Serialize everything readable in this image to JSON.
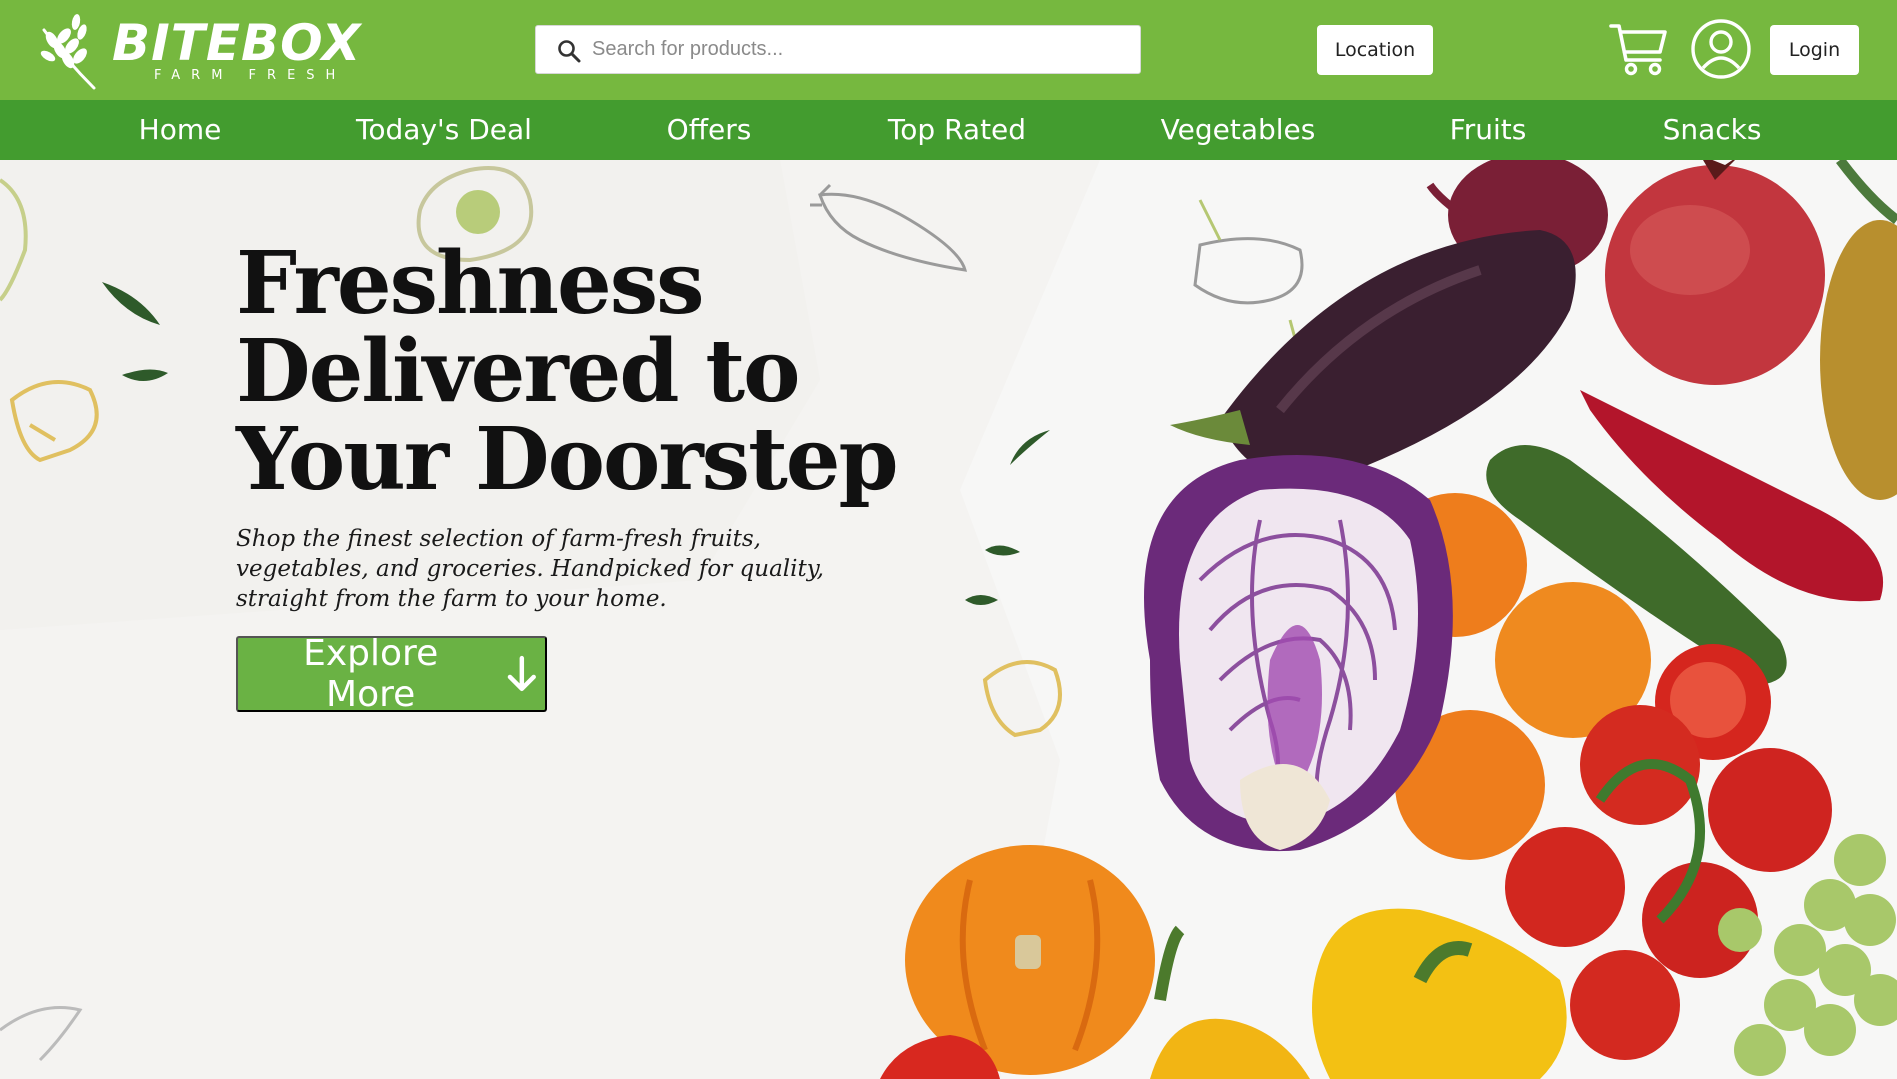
{
  "brand": {
    "name": "BITEBOX",
    "tagline": "FARM FRESH",
    "logo_icon": "wheat-icon"
  },
  "header": {
    "search": {
      "placeholder": "Search for products...",
      "value": "",
      "icon": "search-icon"
    },
    "location_label": "Location",
    "cart_icon": "shopping-cart-icon",
    "account_icon": "user-account-icon",
    "login_label": "Login"
  },
  "nav": {
    "items": [
      {
        "label": "Home"
      },
      {
        "label": "Today's Deal"
      },
      {
        "label": "Offers"
      },
      {
        "label": "Top Rated"
      },
      {
        "label": "Vegetables"
      },
      {
        "label": "Fruits"
      },
      {
        "label": "Snacks"
      }
    ]
  },
  "hero": {
    "headline_line1": "Freshness",
    "headline_line2": "Delivered to",
    "headline_line3": "Your Doorstep",
    "subtext": "Shop the finest selection of farm-fresh fruits, vegetables, and groceries. Handpicked for quality, straight from the farm to your home.",
    "cta_label": "Explore More",
    "cta_icon": "arrow-down-icon",
    "image": "fresh-vegetables-and-fruits-photo"
  },
  "colors": {
    "topbar": "#76b83f",
    "nav": "#439c2f",
    "cta": "#6ab244",
    "text_dark": "#111111"
  }
}
